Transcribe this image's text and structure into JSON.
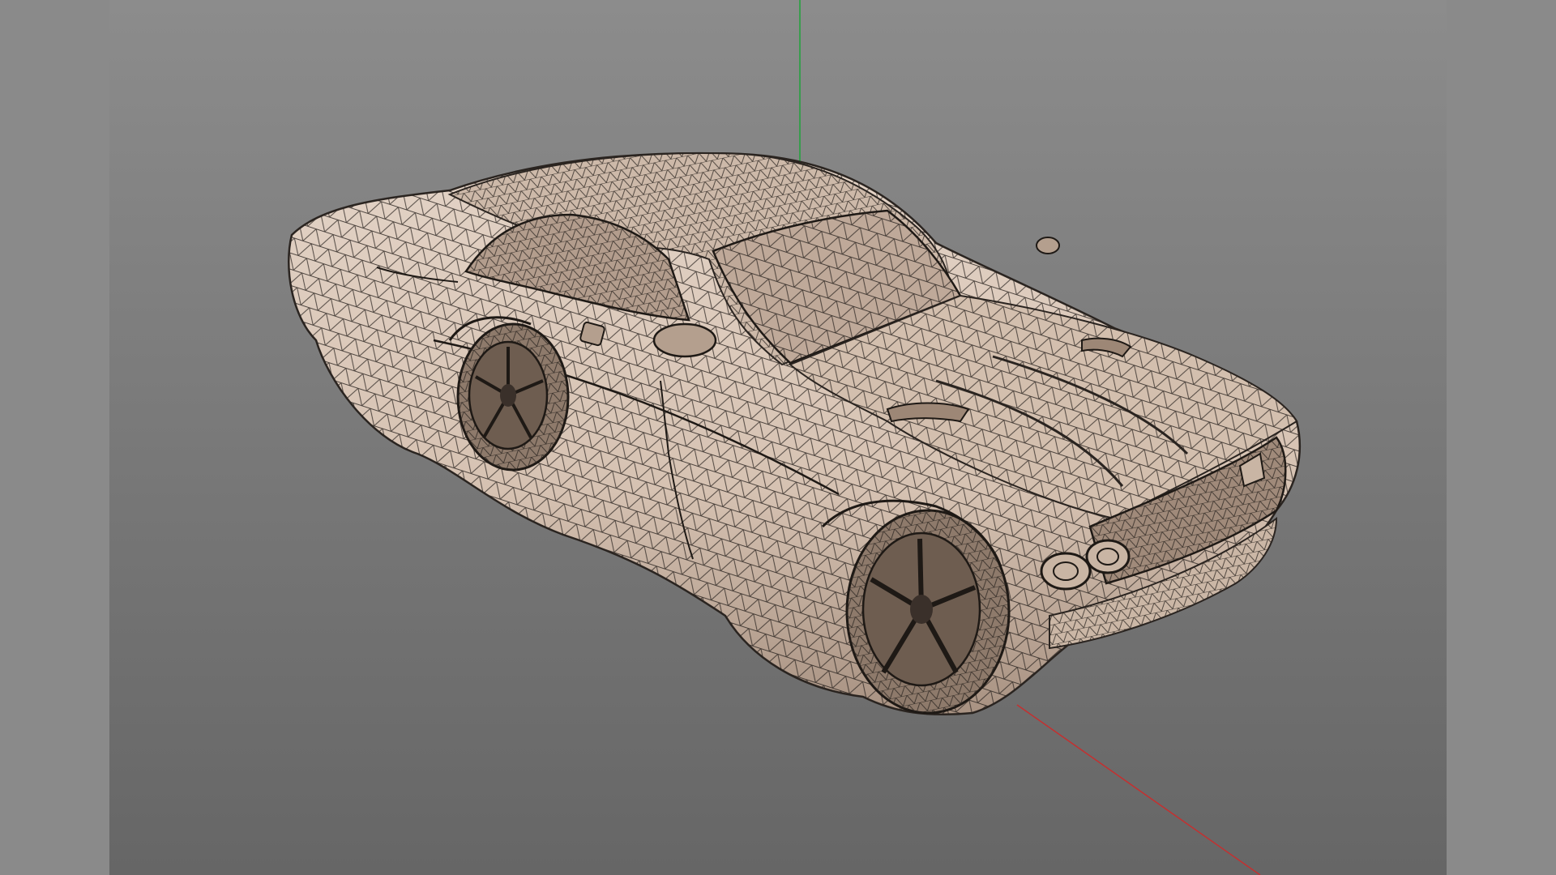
{
  "viewport": {
    "shading_mode": "wireframe-on-shaded",
    "model": "muscle-car",
    "colors": {
      "background_top": "#8c8c8c",
      "background_bottom": "#666666",
      "mesh_fill": "#d9c7b8",
      "mesh_wire": "#2a2420",
      "axis_y": "#1fa33a",
      "axis_x": "#c43030",
      "side_panel": "#8a8a8a"
    },
    "icons": [
      "axis-y-icon",
      "axis-x-icon"
    ]
  }
}
